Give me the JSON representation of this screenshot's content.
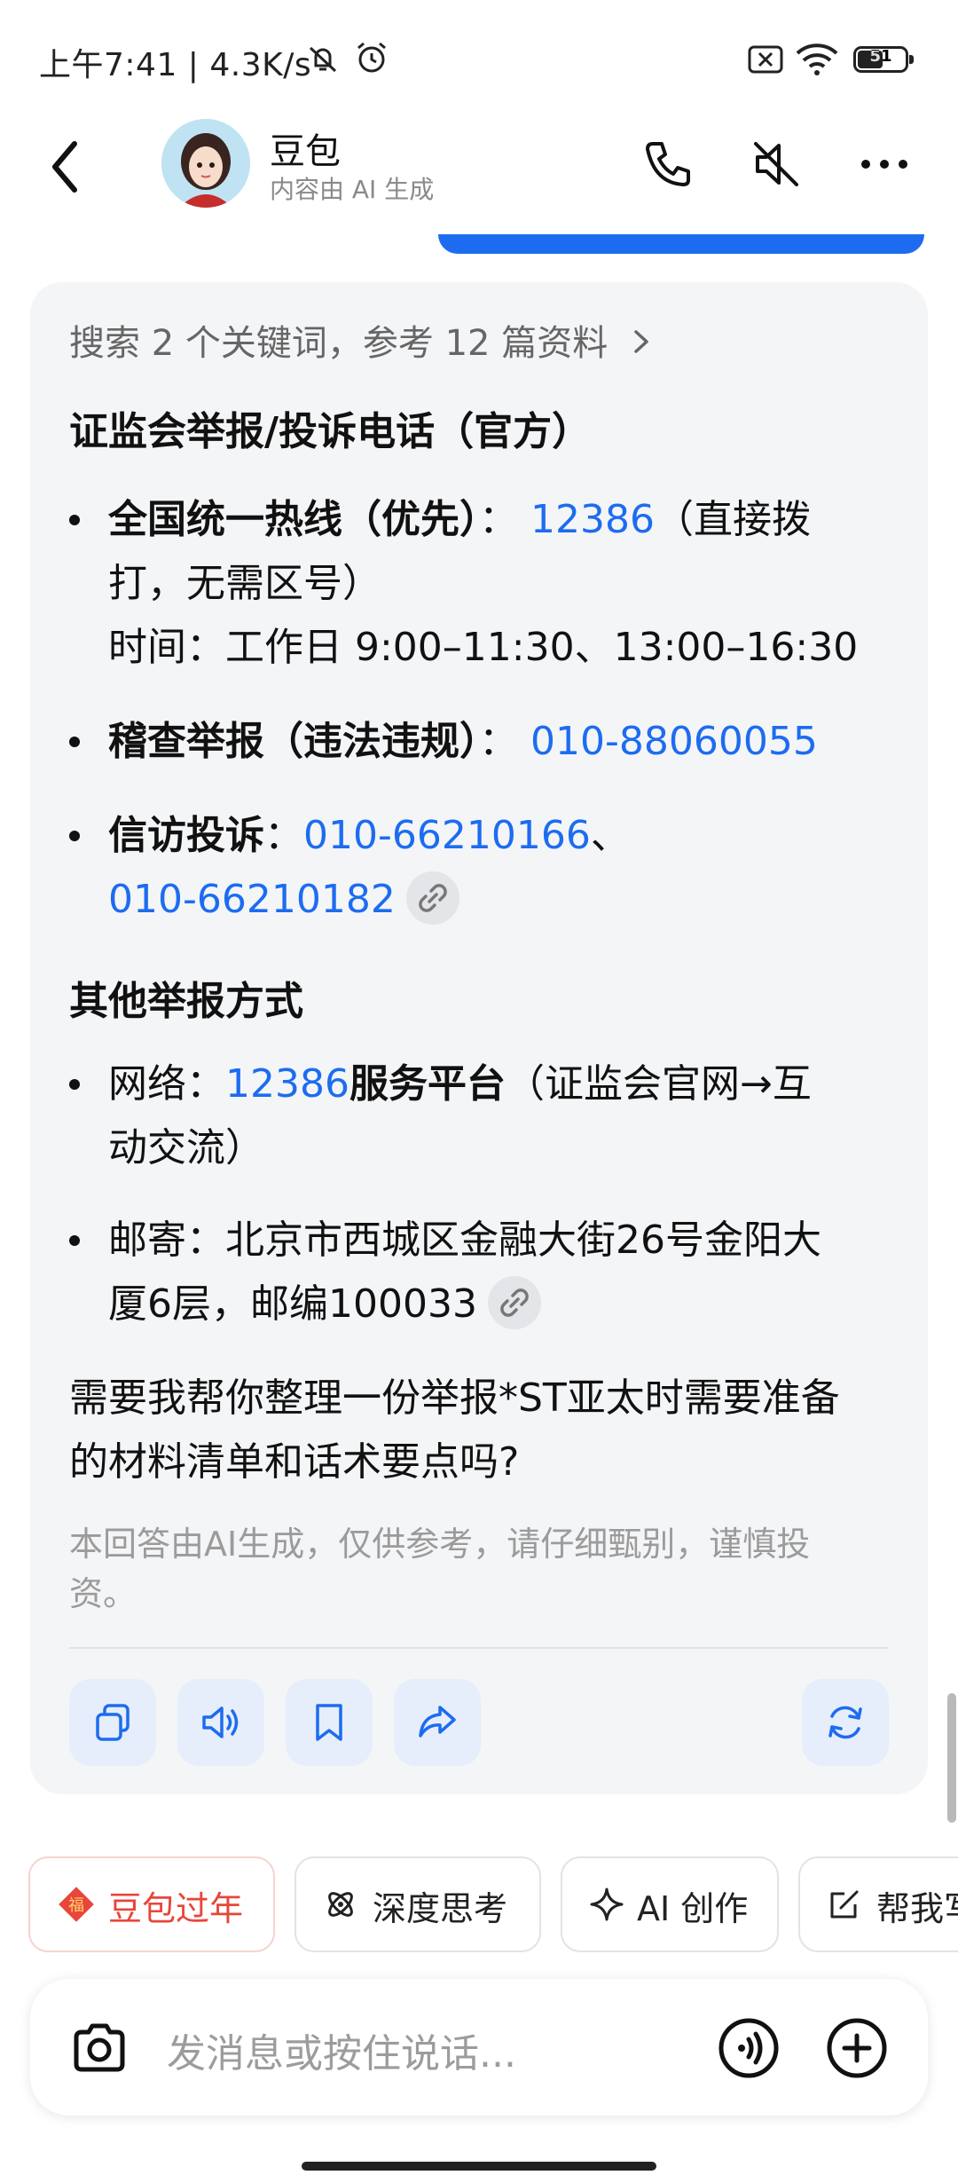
{
  "status_bar": {
    "time": "上午7:41 | 4.3K/s",
    "battery": "51"
  },
  "header": {
    "name": "豆包",
    "subtitle": "内容由 AI 生成"
  },
  "message": {
    "reference": "搜索 2 个关键词，参考 12 篇资料",
    "section1_title": "证监会举报/投诉电话（官方）",
    "item1_bold": "全国统一热线（优先）",
    "item1_sep": "：",
    "item1_number": "12386",
    "item1_note_a": "（直接拨",
    "item1_note_b": "打，无需区号）",
    "item1_hours": "时间：工作日 9:00–11:30、13:00–16:30",
    "item2_bold": "稽查举报（违法违规）",
    "item2_sep": "：",
    "item2_number": "010-88060055",
    "item3_bold": "信访投诉",
    "item3_sep": "：",
    "item3_number1": "010-66210166",
    "item3_join": "、",
    "item3_number2": "010-66210182",
    "section2_title": "其他举报方式",
    "item4_prefix": "网络：",
    "item4_number": "12386",
    "item4_bold": "服务平台",
    "item4_note_a": "（证监会官网→互",
    "item4_note_b": "动交流）",
    "item5_line1": "邮寄：北京市西城区金融大街26号金阳大",
    "item5_line2": "厦6层，邮编100033",
    "followup_line1": "需要我帮你整理一份举报*ST亚太时需要准备",
    "followup_line2": "的材料清单和话术要点吗?",
    "disclaimer_line1": "本回答由AI生成，仅供参考，请仔细甄别，谨慎投",
    "disclaimer_line2": "资。"
  },
  "chips": [
    {
      "label": "豆包过年",
      "icon": "fu-icon",
      "color": "#e8463a"
    },
    {
      "label": "深度思考",
      "icon": "deep-think-icon"
    },
    {
      "label": "AI 创作",
      "icon": "sparkle-icon"
    },
    {
      "label": "帮我写",
      "icon": "edit-icon"
    }
  ],
  "input": {
    "placeholder": "发消息或按住说话..."
  },
  "colors": {
    "accent": "#1d6cf0",
    "card_bg": "#f4f5f7",
    "action_bg": "#e6eefb",
    "festival_red": "#e8463a"
  }
}
